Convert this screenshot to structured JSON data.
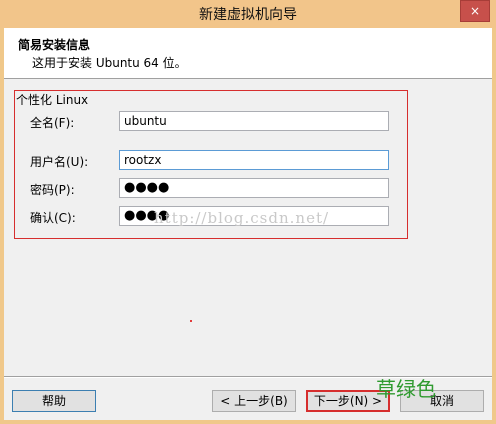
{
  "window": {
    "title": "新建虚拟机向导",
    "close_label": "×"
  },
  "header": {
    "title": "简易安装信息",
    "subtitle": "这用于安装 Ubuntu 64 位。"
  },
  "group": {
    "label": "个性化 Linux"
  },
  "fields": {
    "fullname": {
      "label": "全名(F):",
      "value": "ubuntu"
    },
    "username": {
      "label": "用户名(U):",
      "value": "rootzx"
    },
    "password": {
      "label": "密码(P):",
      "value": "●●●●"
    },
    "confirm": {
      "label": "确认(C):",
      "value": "●●●●"
    }
  },
  "watermark": "http://blog.csdn.net/",
  "buttons": {
    "help": "帮助",
    "back": "< 上一步(B)",
    "next": "下一步(N) >",
    "cancel": "取消"
  },
  "overlay_text": "草绿色"
}
